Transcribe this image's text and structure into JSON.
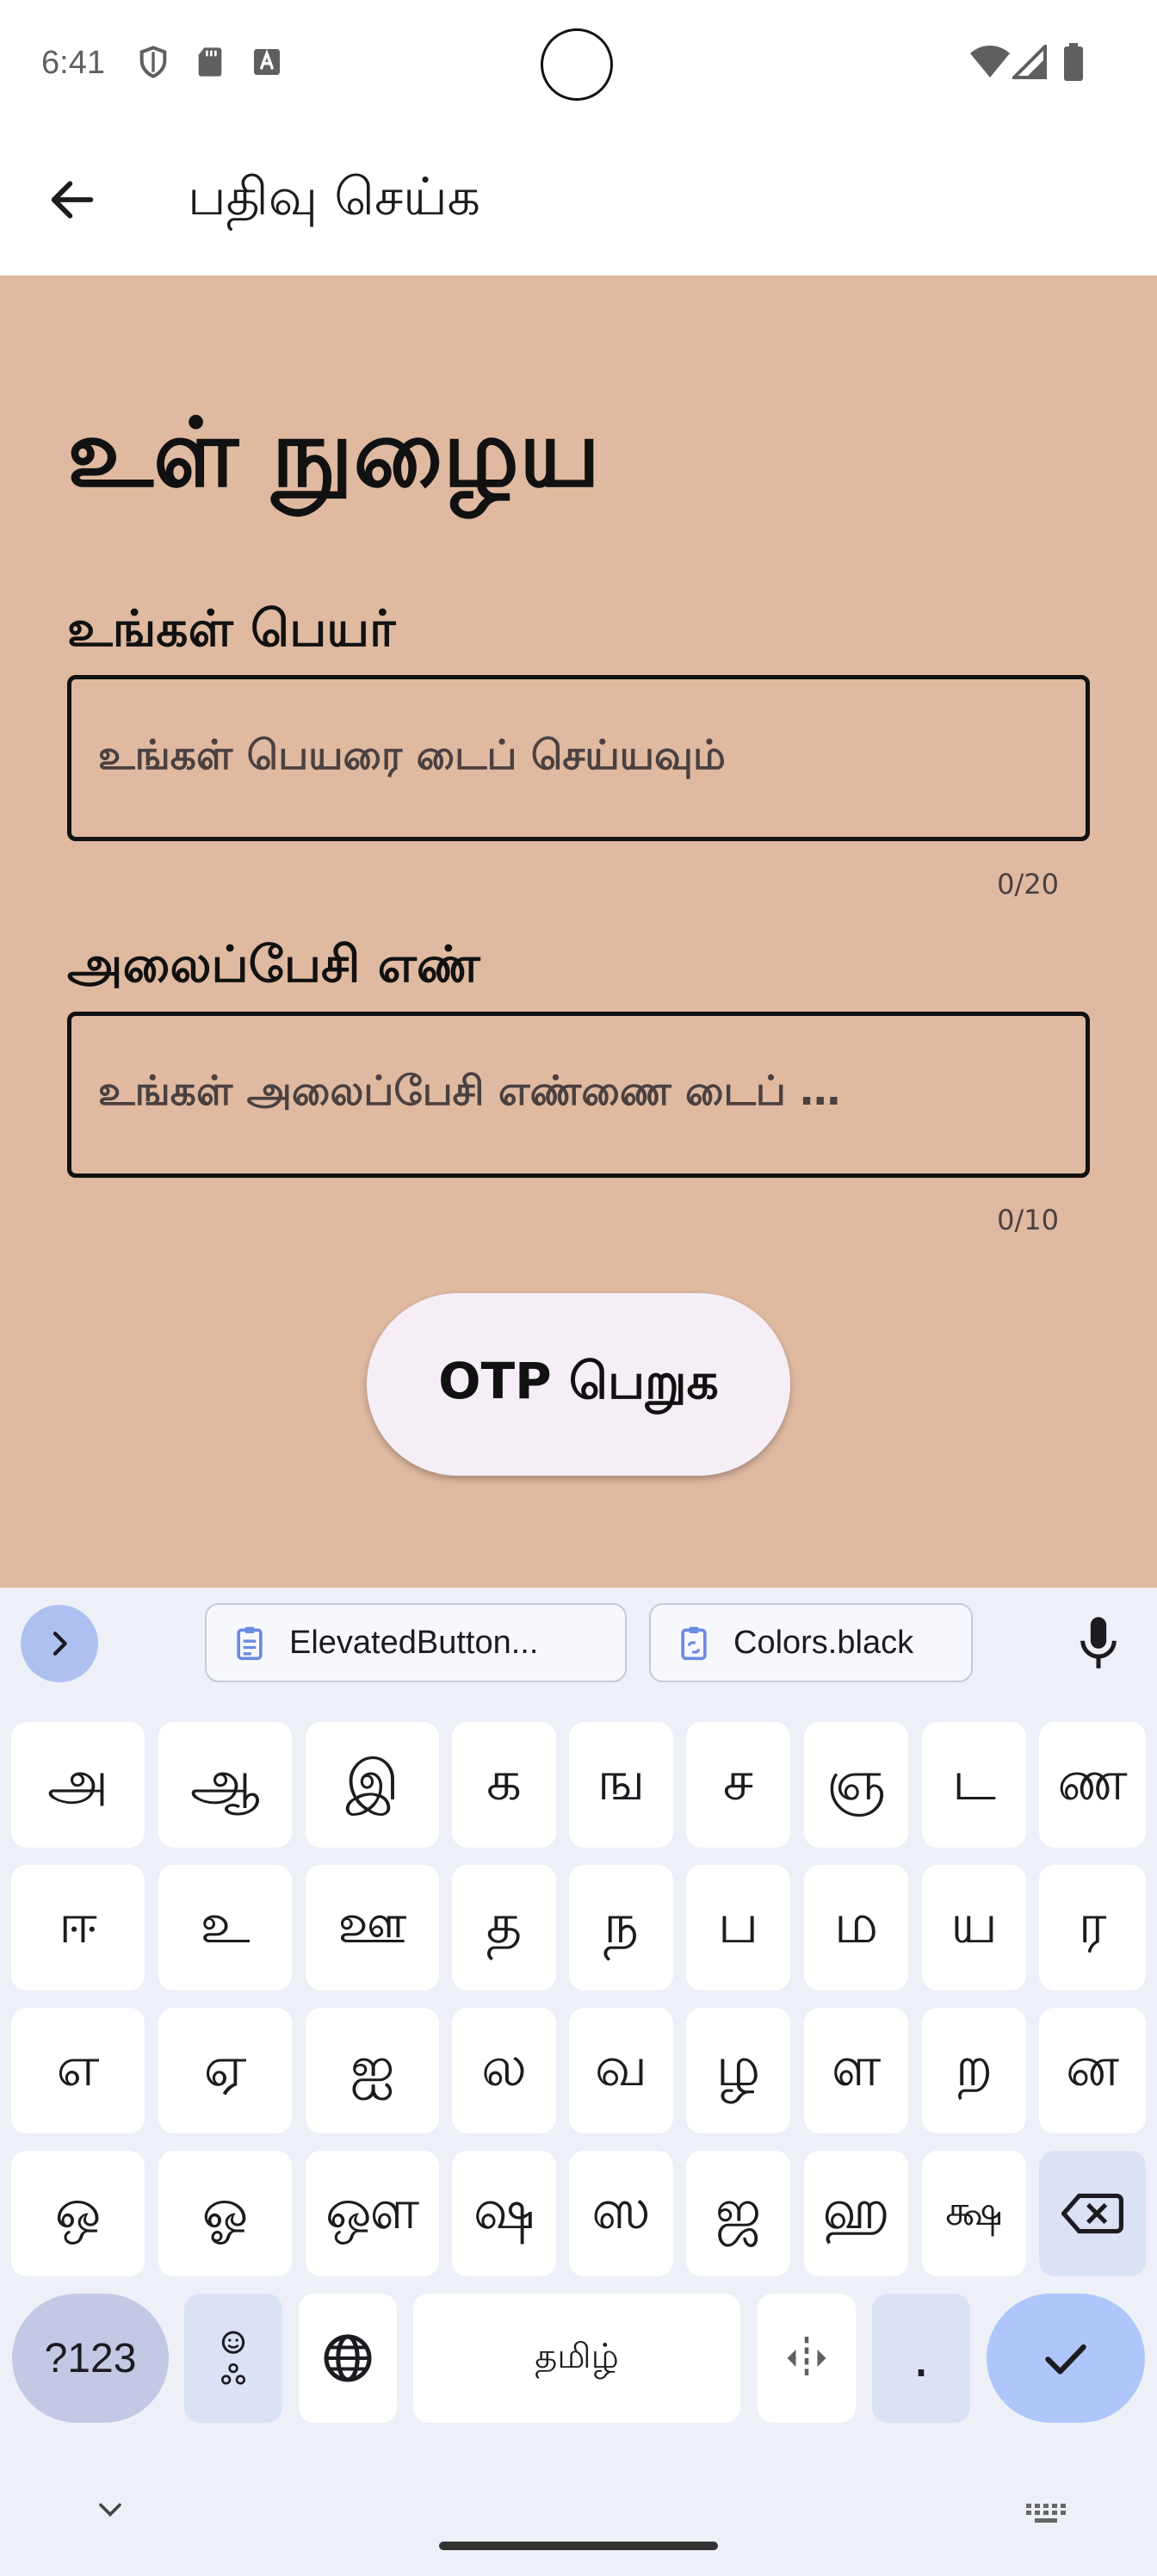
{
  "status_bar": {
    "time": "6:41",
    "icons": [
      "shield-icon",
      "sd-card-icon",
      "font-a-icon",
      "wifi-icon",
      "signal-icon",
      "battery-icon"
    ]
  },
  "app_bar": {
    "title": "பதிவு செய்க",
    "back_icon": "arrow-back-icon"
  },
  "form": {
    "heading": "உள் நுழைய",
    "name_label": "உங்கள் பெயர்",
    "name_placeholder": "உங்கள் பெயரை டைப் செய்யவும்",
    "name_counter": "0/20",
    "phone_label": "அலைப்பேசி எண்",
    "phone_placeholder": "உங்கள் அலைப்பேசி எண்ணை டைப் …",
    "phone_counter": "0/10",
    "otp_button": "OTP பெறுக"
  },
  "colors": {
    "background": "#dfb9a0",
    "button_bg": "#f5eef6",
    "keyboard_bg": "#eef0f8"
  },
  "keyboard": {
    "suggestions": [
      "ElevatedButton...",
      "Colors.black"
    ],
    "rows": [
      [
        "அ",
        "ஆ",
        "இ",
        "க",
        "ங",
        "ச",
        "ஞ",
        "ட",
        "ண"
      ],
      [
        "ஈ",
        "உ",
        "ஊ",
        "த",
        "ந",
        "ப",
        "ம",
        "ய",
        "ர"
      ],
      [
        "எ",
        "ஏ",
        "ஐ",
        "ல",
        "வ",
        "ழ",
        "ள",
        "ற",
        "ன"
      ],
      [
        "ஒ",
        "ஓ",
        "ஔ",
        "ஷ",
        "ஸ",
        "ஜ",
        "ஹ",
        "க்ஷ"
      ]
    ],
    "symbols_key": "?123",
    "space_label": "தமிழ்",
    "period_key": "."
  }
}
